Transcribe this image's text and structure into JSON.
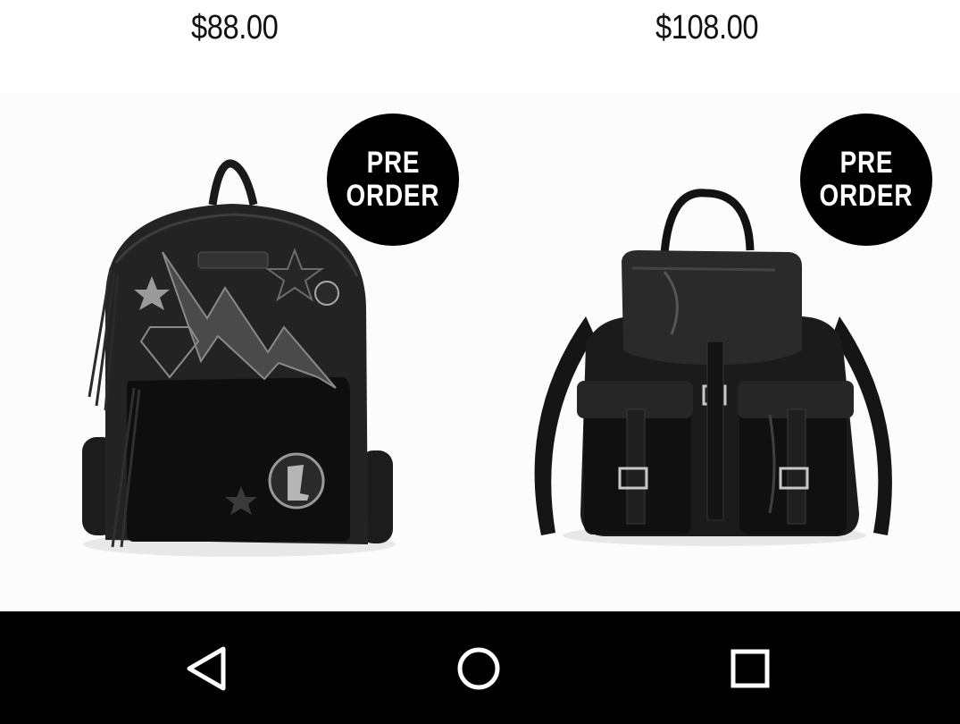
{
  "products": [
    {
      "price": "$88.00",
      "badge_line1": "PRE",
      "badge_line2": "ORDER",
      "image_icon": "studded-leather-backpack-with-patches"
    },
    {
      "price": "$108.00",
      "badge_line1": "PRE",
      "badge_line2": "ORDER",
      "image_icon": "patent-leather-drawstring-backpack"
    }
  ],
  "navbar": {
    "back_icon": "triangle-back-icon",
    "home_icon": "circle-home-icon",
    "recents_icon": "square-recents-icon"
  },
  "colors": {
    "badge": "#000000",
    "navbar": "#000000",
    "nav_icon": "#ffffff"
  }
}
